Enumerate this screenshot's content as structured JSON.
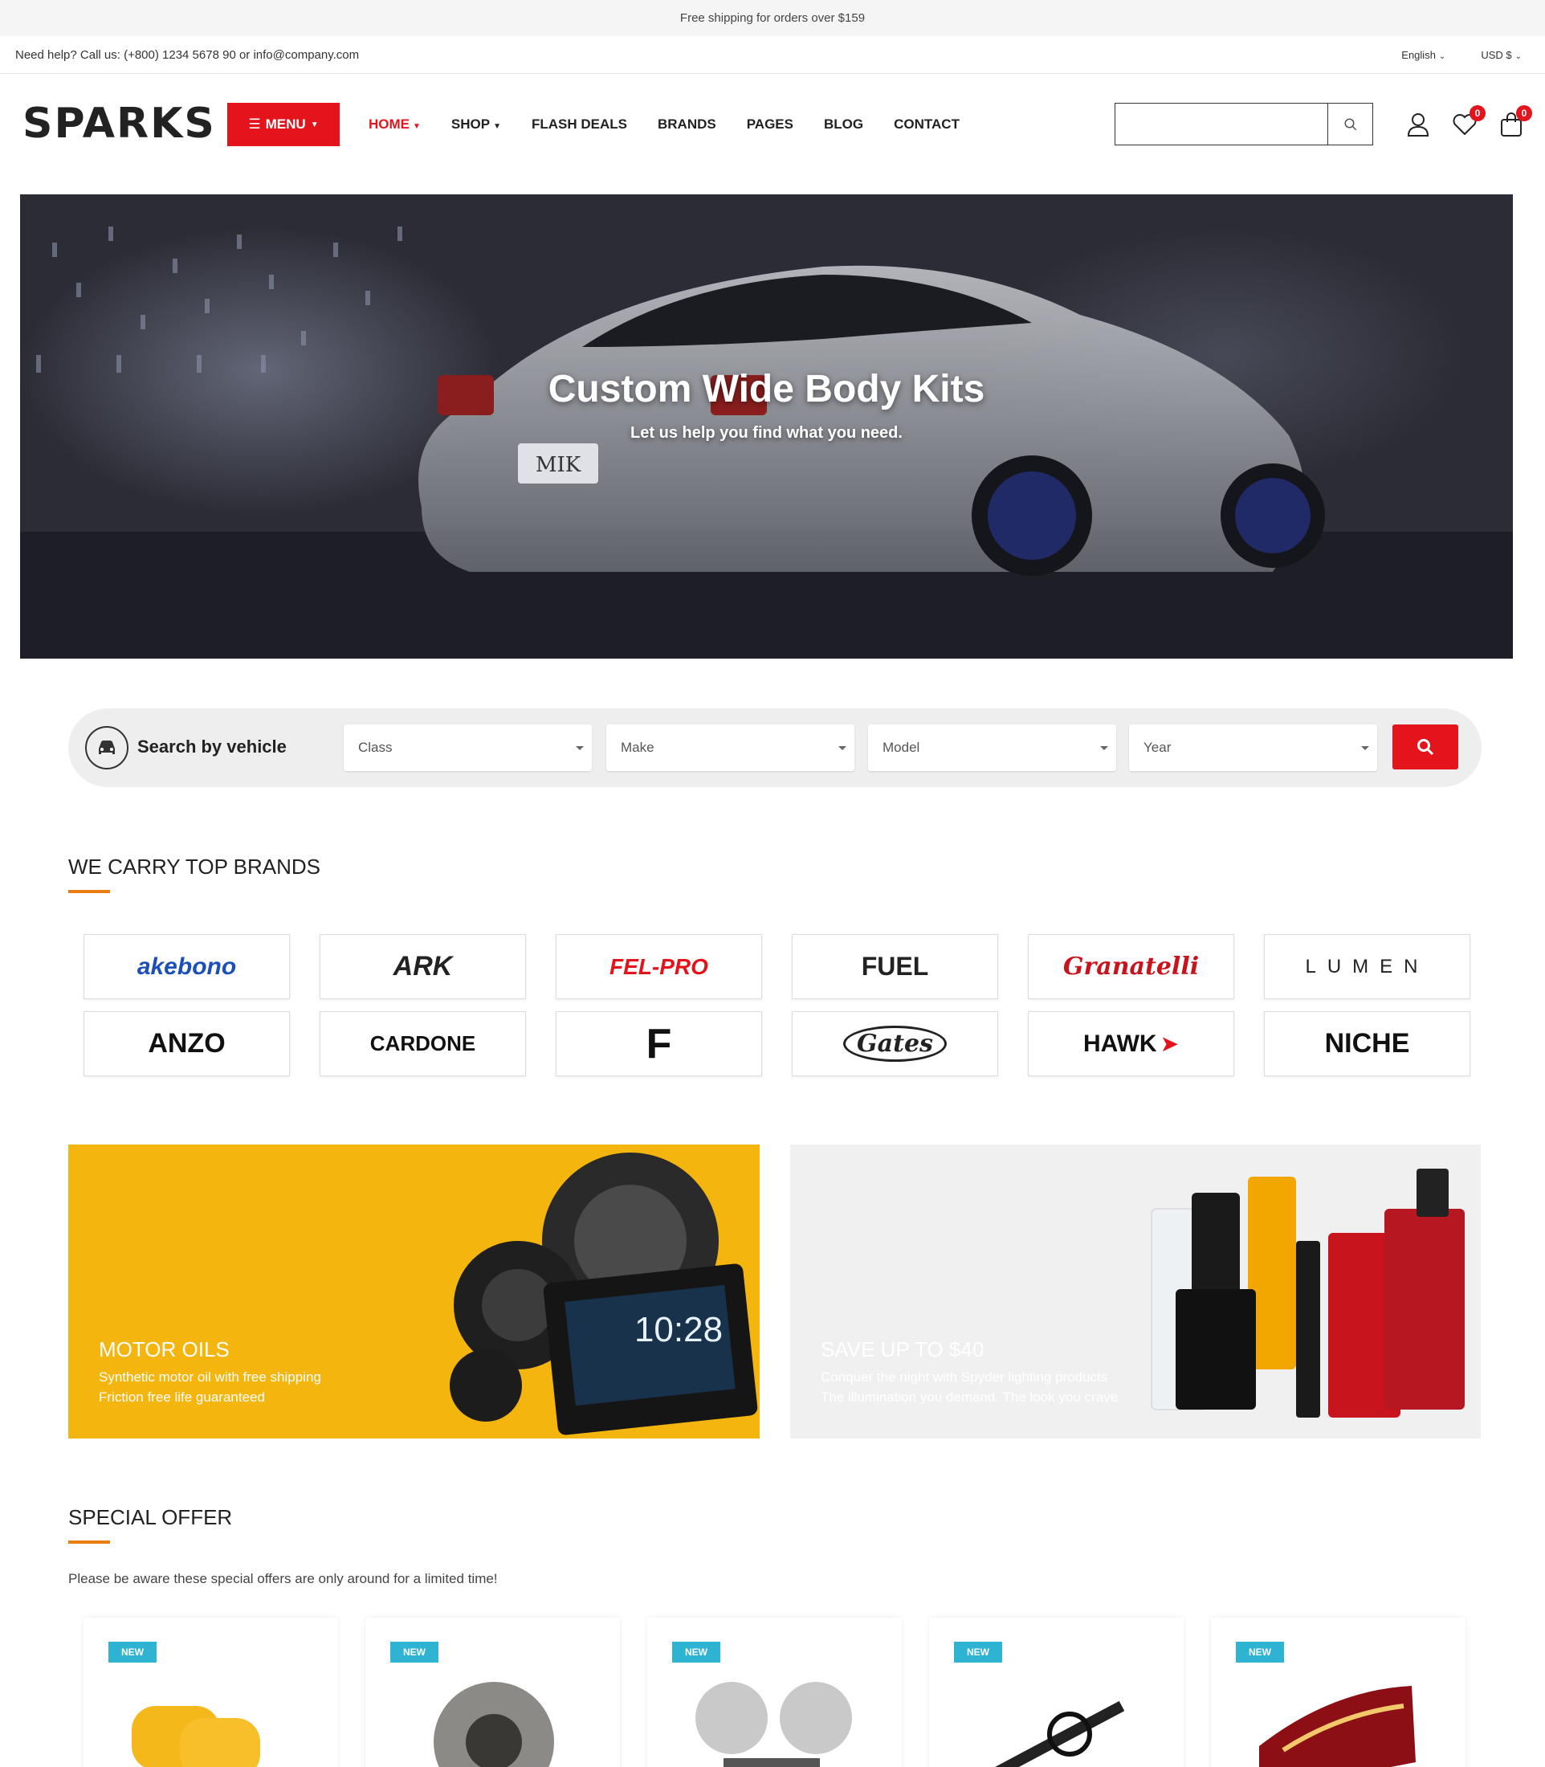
{
  "topbar": {
    "text": "Free shipping for orders over $159"
  },
  "infobar": {
    "help": "Need help? Call us: (+800) 1234 5678 90 or info@company.com",
    "language": "English",
    "currency": "USD $"
  },
  "header": {
    "logo": "SPARKS",
    "menu_label": "MENU",
    "nav": [
      {
        "label": "HOME"
      },
      {
        "label": "SHOP"
      },
      {
        "label": "FLASH DEALS"
      },
      {
        "label": "BRANDS"
      },
      {
        "label": "PAGES"
      },
      {
        "label": "BLOG"
      },
      {
        "label": "CONTACT"
      }
    ],
    "search_placeholder": "",
    "wishlist_count": "0",
    "cart_count": "0",
    "icons": [
      "search-icon",
      "user-icon",
      "heart-icon",
      "bag-icon"
    ]
  },
  "hero": {
    "title": "Custom Wide Body Kits",
    "subtitle": "Let us help you find what you need.",
    "plate": "MIK"
  },
  "vehicle_search": {
    "label": "Search by vehicle",
    "selects": [
      "Class",
      "Make",
      "Model",
      "Year"
    ]
  },
  "brands": {
    "title": "WE CARRY TOP BRANDS",
    "items": [
      "akebono",
      "ARK",
      "FEL-PRO",
      "FUEL",
      "Granatelli",
      "LUMEN",
      "ANZO",
      "CARDONE",
      "F",
      "Gates",
      "HAWK",
      "NICHE"
    ]
  },
  "banners": [
    {
      "title": "MOTOR OILS",
      "line1": "Synthetic motor oil with free shipping",
      "line2": "Friction free life guaranteed"
    },
    {
      "title": "SAVE UP TO $40",
      "line1": "Conquer the night with Spyder lighting products",
      "line2": "The illumination you demand. The look you crave."
    }
  ],
  "special_offer": {
    "title": "SPECIAL OFFER",
    "subtitle": "Please be aware these special offers are only around for a limited time!",
    "products": [
      {
        "tag": "NEW"
      },
      {
        "tag": "NEW"
      },
      {
        "tag": "NEW"
      },
      {
        "tag": "NEW"
      },
      {
        "tag": "NEW"
      }
    ]
  },
  "colors": {
    "accent": "#e4141d",
    "underline": "#e87c11",
    "new_tag": "#2fb3d3"
  }
}
